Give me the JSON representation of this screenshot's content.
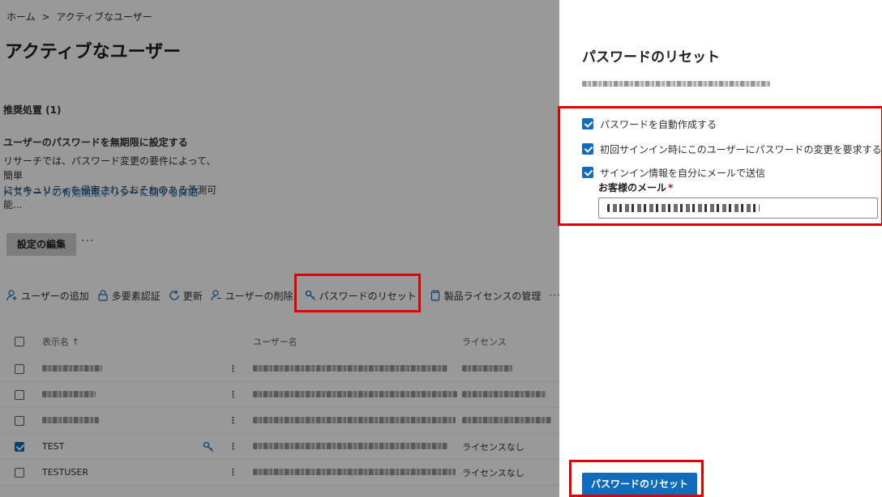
{
  "breadcrumb": {
    "home": "ホーム",
    "separator": ">",
    "current": "アクティブなユーザー"
  },
  "page_title": "アクティブなユーザー",
  "recommendation": {
    "heading": "推奨処置 (1)",
    "title": "ユーザーのパスワードを無期限に設定する",
    "description_line1": "リサーチでは、パスワード変更の要件によって、簡単",
    "description_line2": "にセキュリティを侵害されるおそれのある予測可能...",
    "link": "パスワードの有効期限ポリシーに関する詳細",
    "edit_button": "設定の編集",
    "more": "···"
  },
  "toolbar": {
    "add_user": "ユーザーの追加",
    "mfa": "多要素認証",
    "refresh": "更新",
    "delete_user": "ユーザーの削除",
    "reset_password": "パスワードのリセット",
    "licenses": "製品ライセンスの管理",
    "more": "···"
  },
  "grid": {
    "col_display_name": "表示名 ↑",
    "col_username": "ユーザー名",
    "col_license": "ライセンス",
    "rows": [
      {
        "name": "",
        "license": "",
        "checked": false
      },
      {
        "name": "",
        "license": "",
        "checked": false
      },
      {
        "name": "",
        "license": "",
        "checked": false
      },
      {
        "name": "TEST",
        "license": "ライセンスなし",
        "checked": true
      },
      {
        "name": "TESTUSER",
        "license": "ライセンスなし",
        "checked": false
      }
    ]
  },
  "panel": {
    "title": "パスワードのリセット",
    "auto_create": "パスワードを自動作成する",
    "require_change": "初回サインイン時にこのユーザーにパスワードの変更を要求する",
    "email_signin": "サインイン情報を自分にメールで送信",
    "email_label": "お客様のメール",
    "required_mark": "*",
    "reset_button": "パスワードのリセット"
  },
  "colors": {
    "accent": "#0f6cbd",
    "highlight": "#e00000",
    "required": "#c50f1f"
  }
}
